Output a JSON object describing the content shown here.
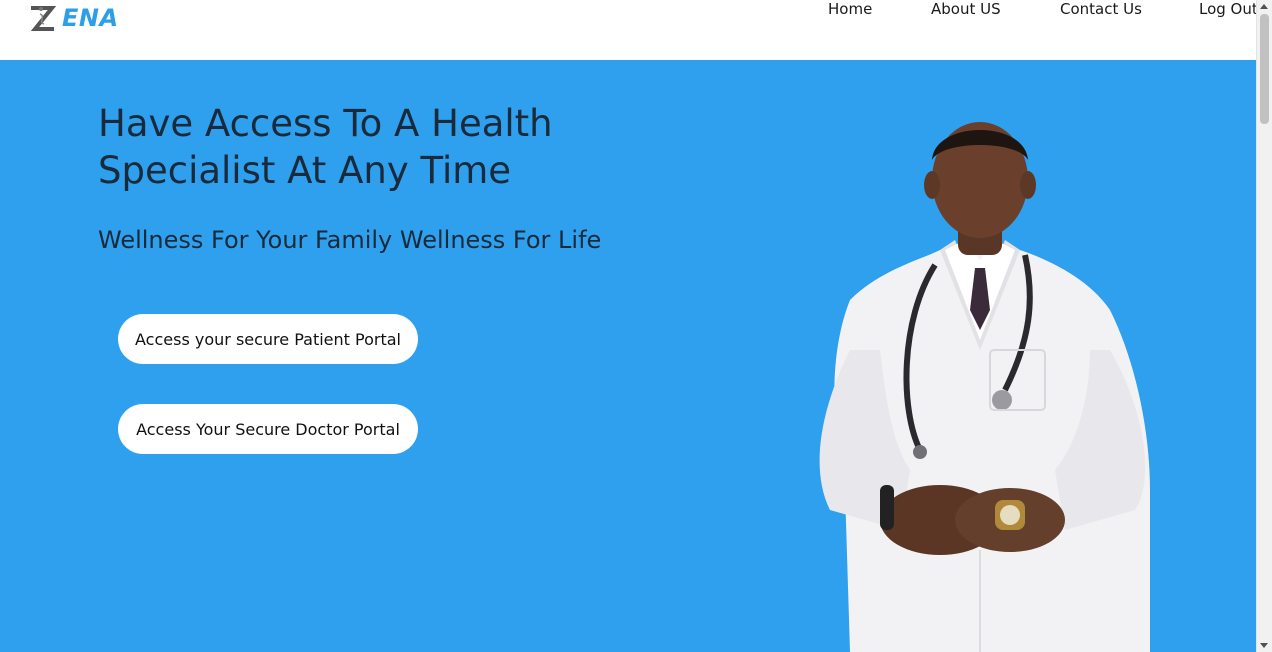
{
  "header": {
    "logo_text": "ENA",
    "nav": [
      {
        "label": "Home"
      },
      {
        "label": "About US"
      },
      {
        "label": "Contact Us"
      },
      {
        "label": "Log Out"
      }
    ]
  },
  "hero": {
    "headline": "Have Access To A Health Specialist At Any Time",
    "subheadline": "Wellness For Your Family Wellness For Life",
    "patient_portal_button": "Access your secure Patient Portal",
    "doctor_portal_button": "Access Your Secure Doctor Portal"
  },
  "colors": {
    "hero_background": "#2ea0ee",
    "logo_accent": "#2d9fe9"
  }
}
